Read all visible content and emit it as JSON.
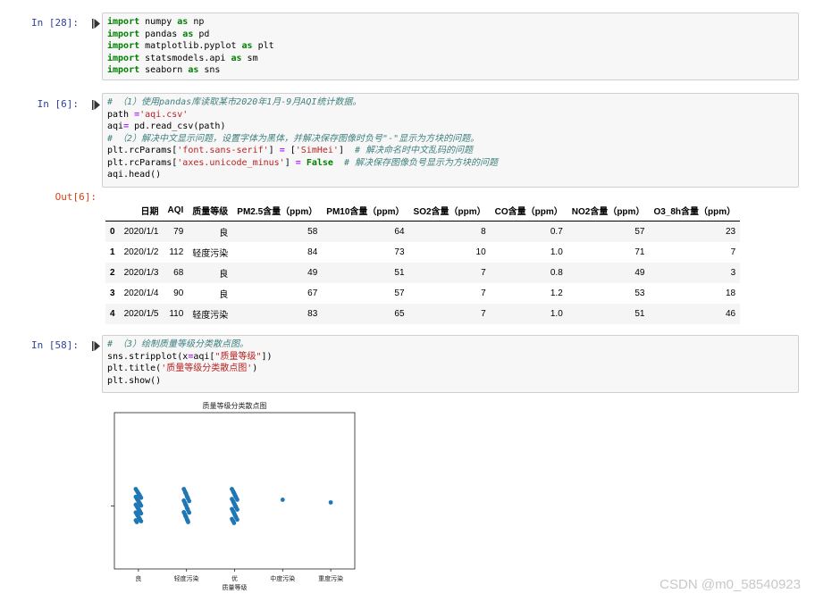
{
  "cells": [
    {
      "prompt": "In  [28]:",
      "lines": [
        [
          {
            "t": "import",
            "c": "kw"
          },
          {
            "t": " numpy "
          },
          {
            "t": "as",
            "c": "kw"
          },
          {
            "t": " np"
          }
        ],
        [
          {
            "t": "import",
            "c": "kw"
          },
          {
            "t": " pandas "
          },
          {
            "t": "as",
            "c": "kw"
          },
          {
            "t": " pd"
          }
        ],
        [
          {
            "t": "import",
            "c": "kw"
          },
          {
            "t": " matplotlib.pyplot "
          },
          {
            "t": "as",
            "c": "kw"
          },
          {
            "t": " plt"
          }
        ],
        [
          {
            "t": "import",
            "c": "kw"
          },
          {
            "t": " statsmodels.api "
          },
          {
            "t": "as",
            "c": "kw"
          },
          {
            "t": " sm"
          }
        ],
        [
          {
            "t": "import",
            "c": "kw"
          },
          {
            "t": " seaborn "
          },
          {
            "t": "as",
            "c": "kw"
          },
          {
            "t": " sns"
          }
        ]
      ]
    },
    {
      "prompt": "In  [6]:",
      "lines": [
        [
          {
            "t": "# （1）使用pandas库读取某市2020年1月-9月AQI统计数据。",
            "c": "cm"
          }
        ],
        [
          {
            "t": "path "
          },
          {
            "t": "=",
            "c": "op"
          },
          {
            "t": "'aqi.csv'",
            "c": "str"
          }
        ],
        [
          {
            "t": "aqi"
          },
          {
            "t": "=",
            "c": "op"
          },
          {
            "t": " pd.read_csv(path)"
          }
        ],
        [
          {
            "t": "# （2）解决中文显示问题，设置字体为黑体，并解决保存图像时负号\"-\"显示为方块的问题。",
            "c": "cm"
          }
        ],
        [
          {
            "t": "plt.rcParams["
          },
          {
            "t": "'font.sans-serif'",
            "c": "str"
          },
          {
            "t": "] "
          },
          {
            "t": "=",
            "c": "op"
          },
          {
            "t": " ["
          },
          {
            "t": "'SimHei'",
            "c": "str"
          },
          {
            "t": "]  "
          },
          {
            "t": "# 解决命名时中文乱码的问题",
            "c": "cm"
          }
        ],
        [
          {
            "t": "plt.rcParams["
          },
          {
            "t": "'axes.unicode_minus'",
            "c": "str"
          },
          {
            "t": "] "
          },
          {
            "t": "=",
            "c": "op"
          },
          {
            "t": " "
          },
          {
            "t": "False",
            "c": "kw"
          },
          {
            "t": "  "
          },
          {
            "t": "# 解决保存图像负号显示为方块的问题",
            "c": "cm"
          }
        ],
        [
          {
            "t": "aqi.head()"
          }
        ]
      ]
    },
    {
      "prompt": "In  [58]:",
      "lines": [
        [
          {
            "t": "# （3）绘制质量等级分类散点图。",
            "c": "cm"
          }
        ],
        [
          {
            "t": "sns.stripplot(x"
          },
          {
            "t": "=",
            "c": "op"
          },
          {
            "t": "aqi["
          },
          {
            "t": "\"质量等级\"",
            "c": "str"
          },
          {
            "t": "])"
          }
        ],
        [
          {
            "t": "plt.title("
          },
          {
            "t": "'质量等级分类散点图'",
            "c": "str"
          },
          {
            "t": ")"
          }
        ],
        [
          {
            "t": "plt.show()"
          }
        ]
      ]
    }
  ],
  "output": {
    "prompt": "Out[6]:",
    "table": {
      "columns": [
        "",
        "日期",
        "AQI",
        "质量等级",
        "PM2.5含量（ppm）",
        "PM10含量（ppm）",
        "SO2含量（ppm）",
        "CO含量（ppm）",
        "NO2含量（ppm）",
        "O3_8h含量（ppm）"
      ],
      "rows": [
        [
          "0",
          "2020/1/1",
          "79",
          "良",
          "58",
          "64",
          "8",
          "0.7",
          "57",
          "23"
        ],
        [
          "1",
          "2020/1/2",
          "112",
          "轻度污染",
          "84",
          "73",
          "10",
          "1.0",
          "71",
          "7"
        ],
        [
          "2",
          "2020/1/3",
          "68",
          "良",
          "49",
          "51",
          "7",
          "0.8",
          "49",
          "3"
        ],
        [
          "3",
          "2020/1/4",
          "90",
          "良",
          "67",
          "57",
          "7",
          "1.2",
          "53",
          "18"
        ],
        [
          "4",
          "2020/1/5",
          "110",
          "轻度污染",
          "83",
          "65",
          "7",
          "1.0",
          "51",
          "46"
        ]
      ]
    }
  },
  "chart_data": {
    "type": "scatter",
    "title": "质量等级分类散点图",
    "xlabel": "质量等级",
    "ylabel": "",
    "categories": [
      "良",
      "轻度污染",
      "优",
      "中度污染",
      "重度污染"
    ],
    "points_per_category": [
      38,
      26,
      30,
      1,
      1
    ],
    "color": "#1f77b4",
    "grid": false
  },
  "watermark": "CSDN @m0_58540923"
}
